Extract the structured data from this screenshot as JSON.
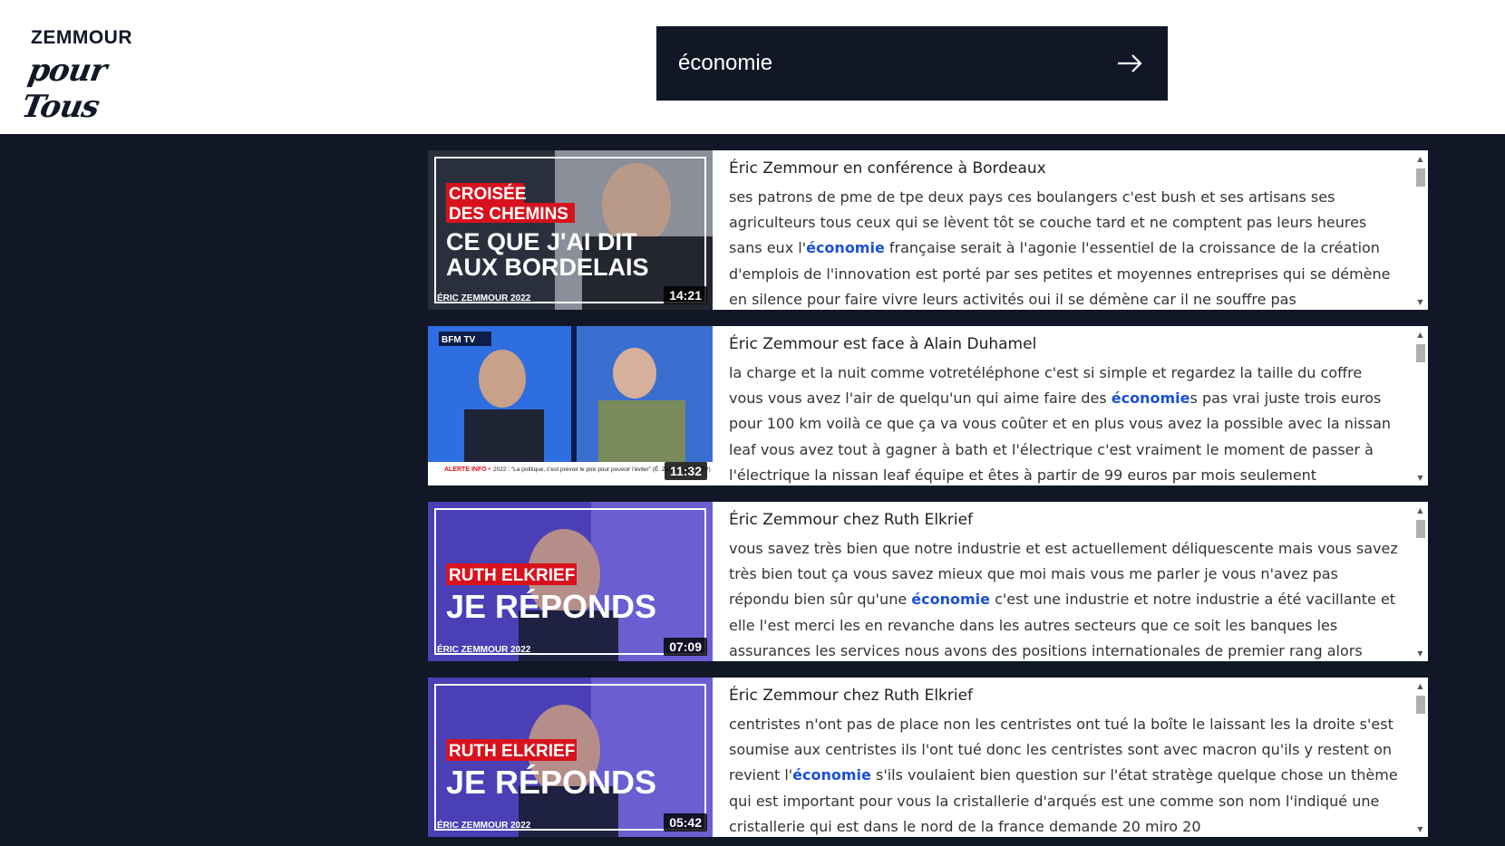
{
  "logo": {
    "top": "ZEMMOUR",
    "script": "pour Tous"
  },
  "search": {
    "value": "économie",
    "submit_icon": "arrow-right-icon"
  },
  "results": [
    {
      "title": "Éric Zemmour en conférence à Bordeaux",
      "duration": "14:21",
      "thumb": {
        "tag1": "CROISÉE",
        "tag2": "DES CHEMINS",
        "headline1": "CE QUE J'AI DIT",
        "headline2": "AUX BORDELAIS",
        "brand": "ÉRIC ZEMMOUR 2022"
      },
      "before": "ses patrons de pme de tpe deux pays ces boulangers c'est bush et ses artisans ses agriculteurs tous ceux qui se lèvent tôt se couche tard et ne comptent pas leurs heures sans eux l'",
      "highlight": "économie",
      "after": " française serait à l'agonie l'essentiel de la croissance de la création d'emplois de l'innovation est porté par ses petites et moyennes entreprises qui se démène en silence pour faire vivre leurs activités oui il se démène car il ne souffre pas"
    },
    {
      "title": "Éric Zemmour est face à Alain Duhamel",
      "duration": "11:32",
      "thumb": {
        "channel": "BFM TV",
        "ticker_label": "ALERTE INFO •",
        "ticker": "2022 : \"La politique, c'est prévoir le pire pour pouvoir l'éviter\" (É. Zemmour/BFMTV)"
      },
      "before": "la charge et la nuit comme votretéléphone c'est si simple et regardez la taille du coffre vous vous avez l'air de quelqu'un qui aime faire des ",
      "highlight": "économie",
      "after": "s pas vrai juste trois euros pour 100 km voilà ce que ça va vous coûter et en plus vous avez la possible avec la nissan leaf vous avez tout à gagner à bath et l'électrique c'est vraiment le moment de passer à l'électrique la nissan leaf équipe et êtes à partir de 99 euros par mois seulement"
    },
    {
      "title": "Éric Zemmour chez Ruth Elkrief",
      "duration": "07:09",
      "thumb": {
        "tag1": "RUTH ELKRIEF",
        "headline1": "JE RÉPONDS",
        "brand": "ÉRIC ZEMMOUR 2022"
      },
      "before": "vous savez très bien que notre industrie et est actuellement déliquescente mais vous savez très bien tout ça vous savez mieux que moi mais vous me parler je vous n'avez pas répondu bien sûr qu'une ",
      "highlight": "économie",
      "after": " c'est une industrie et notre industrie a été vacillante et elle l'est merci les en revanche dans les autres secteurs que ce soit les banques les assurances les services nous avons des positions internationales de premier rang alors"
    },
    {
      "title": "Éric Zemmour chez Ruth Elkrief",
      "duration": "05:42",
      "thumb": {
        "tag1": "RUTH ELKRIEF",
        "headline1": "JE RÉPONDS",
        "brand": "ÉRIC ZEMMOUR 2022"
      },
      "before": "centristes n'ont pas de place non les centristes ont tué la boîte le laissant les la droite s'est soumise aux centristes ils l'ont tué donc les centristes sont avec macron qu'ils y restent on revient l'",
      "highlight": "économie",
      "after": " s'ils voulaient bien question sur l'état stratège quelque chose un thème qui est important pour vous la cristallerie d'arqués est une comme son nom l'indiqué une cristallerie qui est dans le nord de la france demande 20 miro 20"
    }
  ],
  "colors": {
    "navy": "#111726",
    "highlight": "#1a4fd8",
    "red": "#d8121d",
    "purple": "#4a3fb5"
  }
}
